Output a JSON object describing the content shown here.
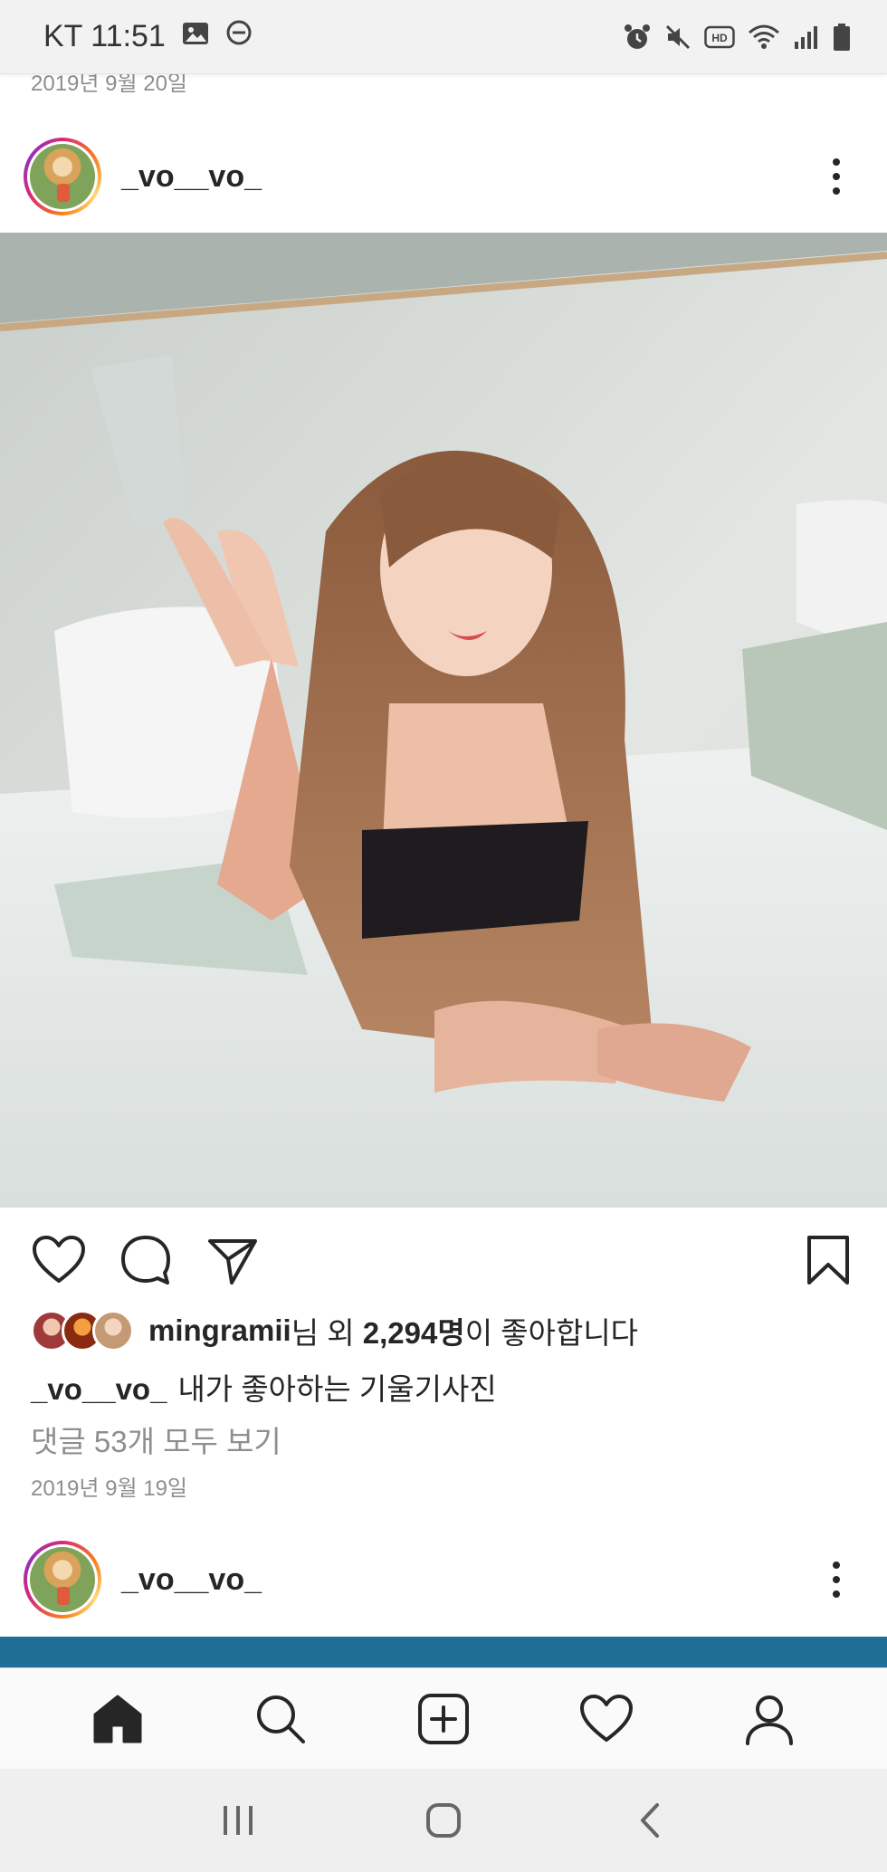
{
  "status_bar": {
    "carrier_time": "KT 11:51",
    "icons_left": [
      "gallery-icon",
      "dnd-icon"
    ],
    "icons_right": [
      "alarm-icon",
      "mute-icon",
      "hd-icon",
      "wifi-icon",
      "signal-icon",
      "battery-icon"
    ],
    "hd_label": "HD"
  },
  "previous_post": {
    "date": "2019년 9월 20일"
  },
  "post": {
    "username": "_vo__vo_",
    "liked_by_user": "mingramii",
    "liked_by_suffix": "님 외 ",
    "like_count": "2,294명",
    "likes_tail": "이 좋아합니다",
    "caption_user": "_vo__vo_",
    "caption_text": "내가 좋아하는 기울기사진",
    "comments_link": "댓글 53개 모두 보기",
    "date": "2019년 9월 19일"
  },
  "next_post": {
    "username": "_vo__vo_"
  },
  "bottom_nav": [
    "home-icon",
    "search-icon",
    "new-post-icon",
    "activity-icon",
    "profile-icon"
  ],
  "colors": {
    "story_ring": "#d62976",
    "text": "#262626",
    "muted": "#8e8e8e",
    "next_strip": "#1f6e95"
  }
}
